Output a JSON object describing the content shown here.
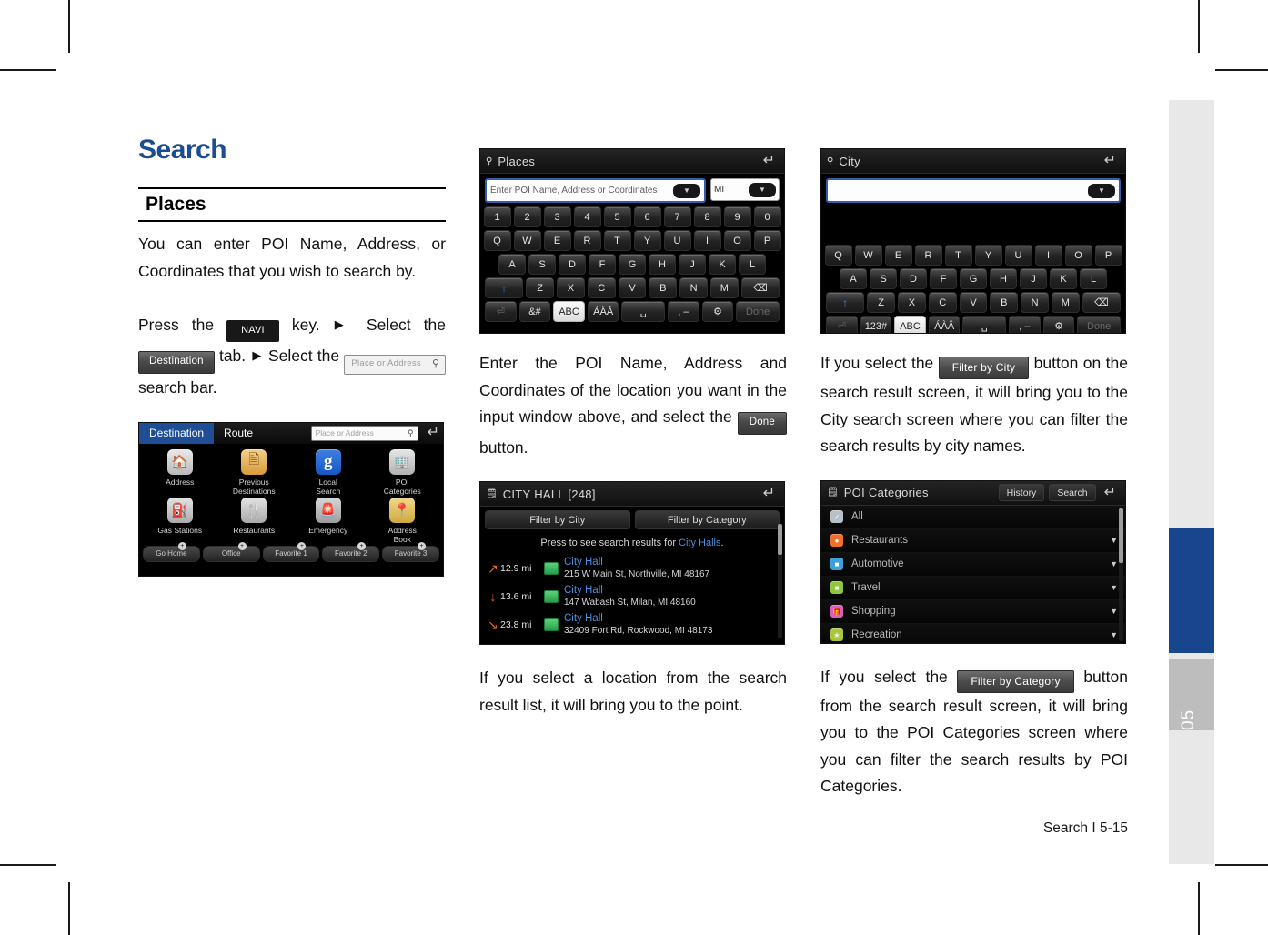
{
  "page": {
    "footer": "Search I 5-15",
    "chapter_tab_number": "05",
    "accent_blue": "#1c4d8f",
    "tab_blue": "#17468c"
  },
  "column1": {
    "title": "Search",
    "section_heading": "Places",
    "paragraph1": "You can enter POI Name, Address, or Coordinates that you wish to search by.",
    "instruction": {
      "part1": "Press the",
      "chip_navi": "NAVI",
      "part2": "key.",
      "arrow": "▶",
      "part3": "Select the",
      "chip_destination": "Destination",
      "part4": "tab.",
      "part5": "Select the",
      "chip_searchbar": "Place or Address",
      "chip_searchbar_icon": "search-icon",
      "part6": "search bar."
    },
    "screenshot_destination": {
      "tabs": [
        {
          "label": "Destination",
          "active": true
        },
        {
          "label": "Route",
          "active": false
        }
      ],
      "search_placeholder": "Place or Address",
      "back_icon": "back-arrow-icon",
      "grid": [
        {
          "label": "Address",
          "icon": "house-icon"
        },
        {
          "label": "Previous\nDestinations",
          "icon": "document-icon"
        },
        {
          "label": "Local\nSearch",
          "icon": "google-g-icon"
        },
        {
          "label": "POI\nCategories",
          "icon": "building-icon"
        },
        {
          "label": "Gas Stations",
          "icon": "fuel-pump-icon"
        },
        {
          "label": "Restaurants",
          "icon": "fork-knife-icon"
        },
        {
          "label": "Emergency",
          "icon": "siren-icon"
        },
        {
          "label": "Address\nBook",
          "icon": "address-book-icon"
        }
      ],
      "footer_buttons": [
        "Go Home",
        "Office",
        "Favorite 1",
        "Favorite 2",
        "Favorite 3"
      ]
    }
  },
  "column2": {
    "screenshot_places": {
      "title": "Places",
      "title_icon": "magnifier-icon",
      "back_icon": "back-arrow-icon",
      "input_placeholder": "Enter POI Name, Address or Coordinates",
      "state_value": "MI",
      "rows": [
        [
          "1",
          "2",
          "3",
          "4",
          "5",
          "6",
          "7",
          "8",
          "9",
          "0"
        ],
        [
          "Q",
          "W",
          "E",
          "R",
          "T",
          "Y",
          "U",
          "I",
          "O",
          "P"
        ],
        [
          "A",
          "S",
          "D",
          "F",
          "G",
          "H",
          "J",
          "K",
          "L"
        ],
        [
          "↑",
          "Z",
          "X",
          "C",
          "V",
          "B",
          "N",
          "M",
          "⌫"
        ],
        [
          "⏎",
          "&#",
          "ABC",
          "ÁÀÂ",
          "␣",
          ", –",
          "⚙",
          "Done"
        ]
      ]
    },
    "paragraph1": {
      "text_before": "Enter the POI Name, Address and Coordinates of the location you want in the input window above, and select the",
      "chip": "Done",
      "text_after": "button."
    },
    "screenshot_results": {
      "title": "CITY HALL [248]",
      "title_icon": "list-search-icon",
      "back_icon": "back-arrow-icon",
      "filter_buttons": [
        "Filter by City",
        "Filter by Category"
      ],
      "press_text_before": "Press to see search results for",
      "press_text_link": "City Halls",
      "press_text_after": ".",
      "results": [
        {
          "direction": "↗",
          "distance": "12.9 mi",
          "name": "City Hall",
          "address": "215 W Main St, Northville, MI 48167"
        },
        {
          "direction": "↓",
          "distance": "13.6 mi",
          "name": "City Hall",
          "address": "147 Wabash St, Milan, MI 48160"
        },
        {
          "direction": "↘",
          "distance": "23.8 mi",
          "name": "City Hall",
          "address": "32409 Fort Rd, Rockwood, MI 48173"
        }
      ]
    },
    "paragraph2": "If you select a location from the search result list, it will bring you to the point."
  },
  "column3": {
    "screenshot_city": {
      "title": "City",
      "title_icon": "magnifier-icon",
      "back_icon": "back-arrow-icon",
      "input_value": "",
      "rows": [
        [
          "Q",
          "W",
          "E",
          "R",
          "T",
          "Y",
          "U",
          "I",
          "O",
          "P"
        ],
        [
          "A",
          "S",
          "D",
          "F",
          "G",
          "H",
          "J",
          "K",
          "L"
        ],
        [
          "↑",
          "Z",
          "X",
          "C",
          "V",
          "B",
          "N",
          "M",
          "⌫"
        ],
        [
          "⏎",
          "123#",
          "ABC",
          "ÁÀÂ",
          "␣",
          ", –",
          "⚙",
          "Done"
        ]
      ]
    },
    "paragraph1": {
      "text_before": "If you select the",
      "chip": "Filter by City",
      "text_after": "button on the search result screen, it will bring you to the City search screen where you can filter the search results by city names."
    },
    "screenshot_poi": {
      "title": "POI Categories",
      "title_icon": "poi-search-icon",
      "header_buttons": [
        "History",
        "Search"
      ],
      "back_icon": "back-arrow-icon",
      "categories": [
        {
          "label": "All",
          "icon": "checklist-icon",
          "color": "#b8c0c8",
          "chevron": false
        },
        {
          "label": "Restaurants",
          "icon": "restaurant-icon",
          "color": "#f0702a",
          "chevron": true
        },
        {
          "label": "Automotive",
          "icon": "car-icon",
          "color": "#3f9fd8",
          "chevron": true
        },
        {
          "label": "Travel",
          "icon": "travel-icon",
          "color": "#8fc83c",
          "chevron": true
        },
        {
          "label": "Shopping",
          "icon": "gift-icon",
          "color": "#d85fc0",
          "chevron": true
        },
        {
          "label": "Recreation",
          "icon": "recreation-icon",
          "color": "#a8c83c",
          "chevron": true
        }
      ]
    },
    "paragraph2": {
      "text_before": "If you select the",
      "chip": "Filter by Category",
      "text_after": "button from the search result screen, it will bring you to the POI Categories screen where you can filter the search results by POI Categories."
    }
  }
}
